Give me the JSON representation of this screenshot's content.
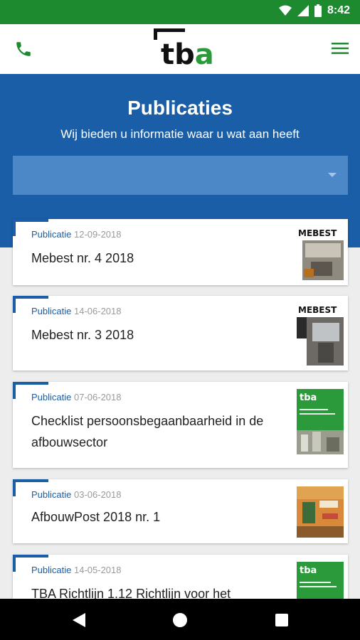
{
  "status": {
    "time": "8:42"
  },
  "header": {
    "logo_text": "tba"
  },
  "hero": {
    "title": "Publicaties",
    "subtitle": "Wij bieden u informatie waar u wat aan heeft",
    "filter_value": ""
  },
  "publications": [
    {
      "type": "Publicatie",
      "date": "12-09-2018",
      "title": "Mebest nr. 4 2018",
      "thumb_label": "MEBEST"
    },
    {
      "type": "Publicatie",
      "date": "14-06-2018",
      "title": "Mebest nr. 3 2018",
      "thumb_label": "MEBEST"
    },
    {
      "type": "Publicatie",
      "date": "07-06-2018",
      "title": "Checklist persoonsbegaanbaarheid in de afbouwsector",
      "thumb_label": "tba"
    },
    {
      "type": "Publicatie",
      "date": "03-06-2018",
      "title": "AfbouwPost 2018 nr. 1",
      "thumb_label": ""
    },
    {
      "type": "Publicatie",
      "date": "14-05-2018",
      "title": "TBA Richtlijn 1.12 Richtlijn voor het",
      "thumb_label": "tba"
    }
  ],
  "colors": {
    "status_green": "#1d8a2f",
    "brand_blue": "#1a5ea8",
    "brand_green": "#2a9a3a"
  }
}
